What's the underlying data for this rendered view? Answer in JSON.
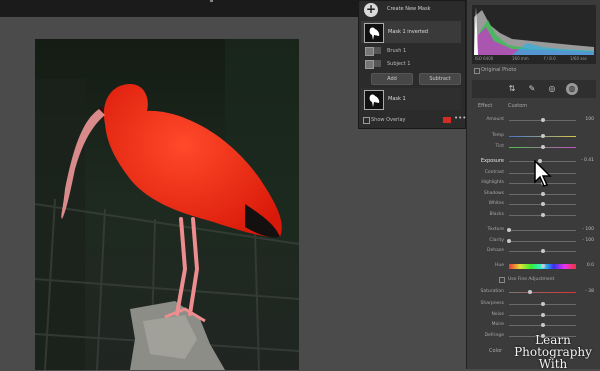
{
  "mask_panel": {
    "create_label": "Create New Mask",
    "masks": [
      {
        "name": "Mask 1 inverted",
        "components": [
          {
            "label": "Brush 1"
          },
          {
            "label": "Subject 1"
          }
        ]
      },
      {
        "name": "Mask 1"
      }
    ],
    "add_label": "Add",
    "subtract_label": "Subtract",
    "show_overlay_label": "Show Overlay",
    "overlay_color": "#d42c22"
  },
  "histogram": {
    "readouts": [
      "ISO 6400",
      "160 mm",
      "f / 8.0",
      "1/60 sec"
    ],
    "original_photo_label": "Original Photo"
  },
  "effect": {
    "label": "Effect",
    "preset": "Custom"
  },
  "sliders": [
    {
      "label": "Amount",
      "value": "100",
      "pos": 0.5
    },
    {
      "label": "Temp",
      "value": "",
      "pos": 0.5,
      "kind": "temp"
    },
    {
      "label": "Tint",
      "value": "",
      "pos": 0.5,
      "kind": "tint"
    },
    {
      "label": "Exposure",
      "value": "- 0.41",
      "pos": 0.47,
      "bright": true
    },
    {
      "label": "Contrast",
      "value": "",
      "pos": 0.5
    },
    {
      "label": "Highlights",
      "value": "",
      "pos": 0.5
    },
    {
      "label": "Shadows",
      "value": "",
      "pos": 0.5
    },
    {
      "label": "Whites",
      "value": "",
      "pos": 0.5
    },
    {
      "label": "Blacks",
      "value": "",
      "pos": 0.5
    },
    {
      "label": "Texture",
      "value": "- 100",
      "pos": 0.0
    },
    {
      "label": "Clarity",
      "value": "- 100",
      "pos": 0.0
    },
    {
      "label": "Dehaze",
      "value": "",
      "pos": 0.5
    },
    {
      "label": "Hue",
      "value": "0.0",
      "pos": 0.5,
      "kind": "hue"
    },
    {
      "label": "Saturation",
      "value": "- 38",
      "pos": 0.31,
      "kind": "sat"
    },
    {
      "label": "Sharpness",
      "value": "",
      "pos": 0.5
    },
    {
      "label": "Noise",
      "value": "",
      "pos": 0.5
    },
    {
      "label": "Moire",
      "value": "",
      "pos": 0.5
    },
    {
      "label": "Defringe",
      "value": "",
      "pos": 0.5
    }
  ],
  "fine_hue_label": "Use Fine Adjustment",
  "color_label": "Color",
  "watermark": {
    "line1": "Learn",
    "line2": "Photography",
    "line3": "With"
  },
  "colors": {
    "accent": "#d42c22",
    "bird": "#ee2a14",
    "panel": "#3b3b3b"
  }
}
